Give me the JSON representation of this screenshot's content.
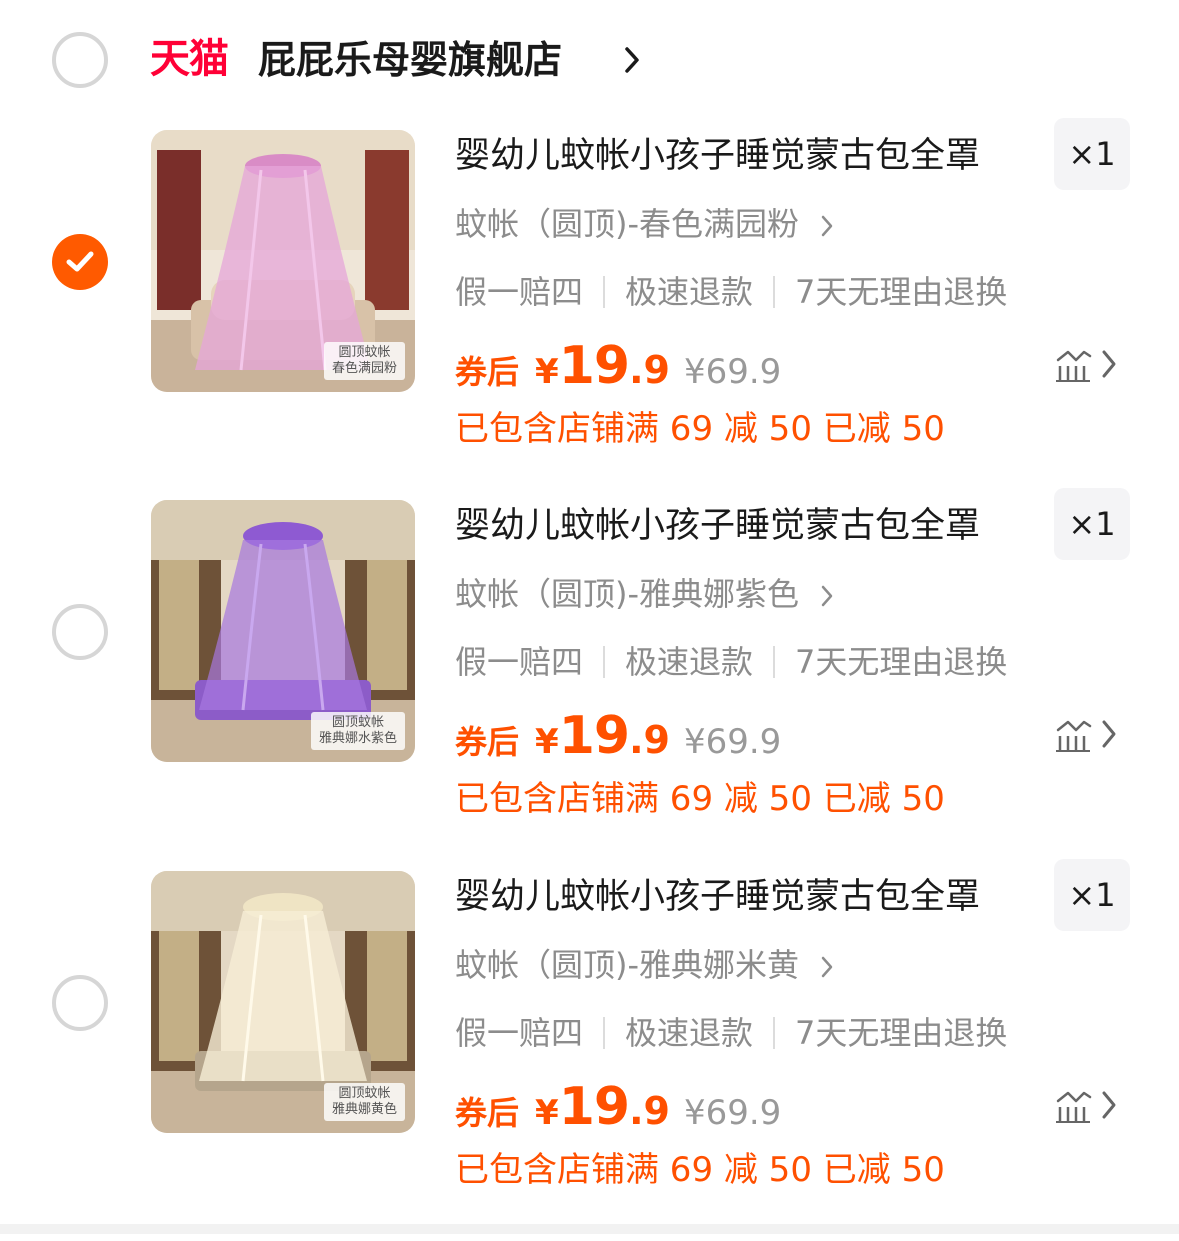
{
  "store": {
    "logo_text": "天猫",
    "name": "屁屁乐母婴旗舰店",
    "selected": false
  },
  "colors": {
    "accent": "#ff5000",
    "tmall_red": "#ff0036",
    "radio_border": "#d6d6d6"
  },
  "items": [
    {
      "selected": true,
      "title": "婴幼儿蚊帐小孩子睡觉蒙古包全罩",
      "quantity": "×1",
      "sku": "蚊帐（圆顶)-春色满园粉",
      "guarantees": [
        "假一赔四",
        "极速退款",
        "7天无理由退换"
      ],
      "price_label": "券后",
      "currency": "¥",
      "price_int": "19",
      "price_dec": ".9",
      "original_price": "¥69.9",
      "discount_text": "已包含店铺满 69 减 50 已减 50",
      "image_caption_1": "圆顶蚊帐",
      "image_caption_2": "春色满园粉",
      "net_color": "pink"
    },
    {
      "selected": false,
      "title": "婴幼儿蚊帐小孩子睡觉蒙古包全罩",
      "quantity": "×1",
      "sku": "蚊帐（圆顶)-雅典娜紫色",
      "guarantees": [
        "假一赔四",
        "极速退款",
        "7天无理由退换"
      ],
      "price_label": "券后",
      "currency": "¥",
      "price_int": "19",
      "price_dec": ".9",
      "original_price": "¥69.9",
      "discount_text": "已包含店铺满 69 减 50 已减 50",
      "image_caption_1": "圆顶蚊帐",
      "image_caption_2": "雅典娜水紫色",
      "net_color": "purple"
    },
    {
      "selected": false,
      "title": "婴幼儿蚊帐小孩子睡觉蒙古包全罩",
      "quantity": "×1",
      "sku": "蚊帐（圆顶)-雅典娜米黄",
      "guarantees": [
        "假一赔四",
        "极速退款",
        "7天无理由退换"
      ],
      "price_label": "券后",
      "currency": "¥",
      "price_int": "19",
      "price_dec": ".9",
      "original_price": "¥69.9",
      "discount_text": "已包含店铺满 69 减 50 已减 50",
      "image_caption_1": "圆顶蚊帐",
      "image_caption_2": "雅典娜黄色",
      "net_color": "beige"
    }
  ]
}
